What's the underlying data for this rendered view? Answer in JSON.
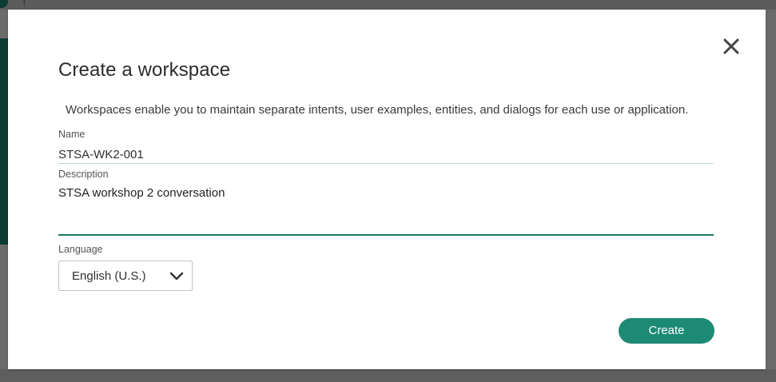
{
  "dialog": {
    "title": "Create a workspace",
    "description": "Workspaces enable you to maintain separate intents, user examples, entities, and dialogs for each use or application.",
    "close_icon": "close-icon"
  },
  "form": {
    "name_label": "Name",
    "name_value": "STSA-WK2-001",
    "description_label": "Description",
    "description_value": "STSA workshop 2 conversation",
    "language_label": "Language",
    "language_selected": "English (U.S.)",
    "language_icon": "chevron-down-icon"
  },
  "actions": {
    "create_label": "Create"
  },
  "colors": {
    "accent": "#1d8a74",
    "focus_underline": "#1d7a66",
    "backdrop": "#6b6b6b"
  }
}
